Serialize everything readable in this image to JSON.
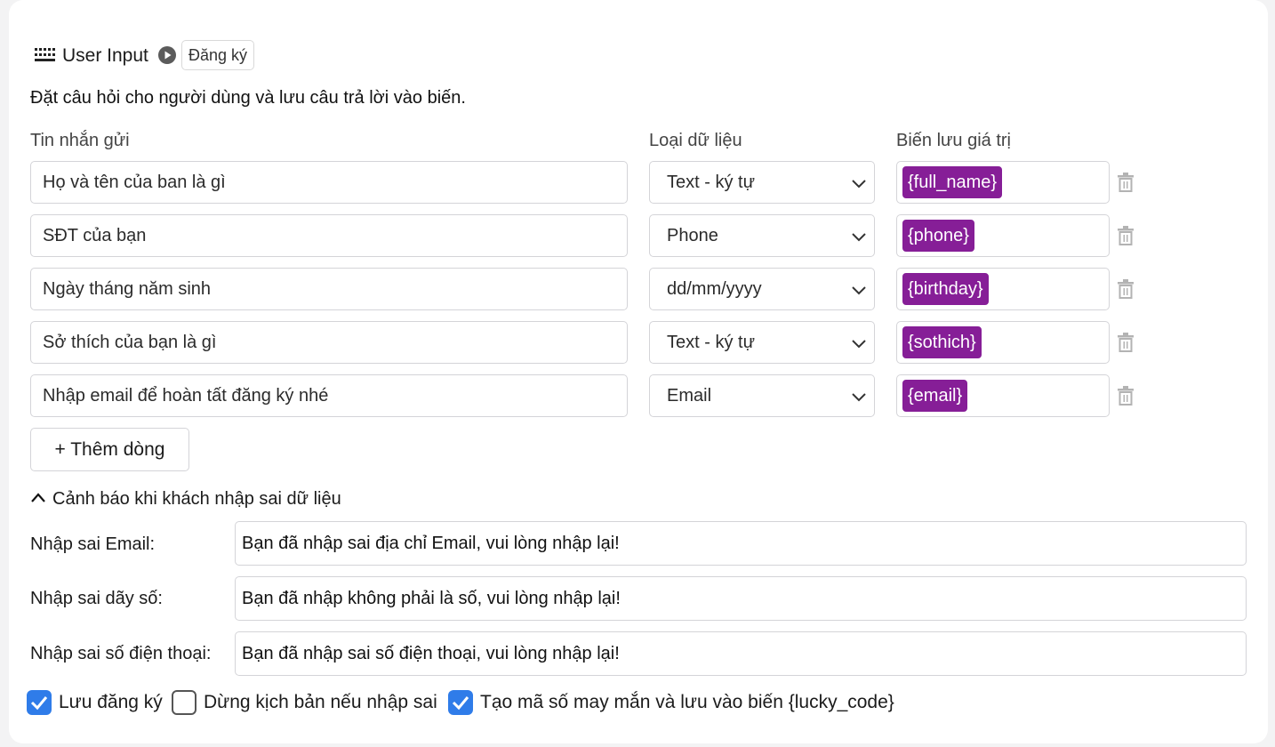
{
  "block": {
    "icon": "keyboard-icon",
    "title": "User Input",
    "run_icon": "play-icon",
    "tag": "Đăng ký",
    "description": "Đặt câu hỏi cho người dùng và lưu câu trả lời vào biến."
  },
  "columns": {
    "message": "Tin nhắn gửi",
    "type": "Loại dữ liệu",
    "variable": "Biến lưu giá trị"
  },
  "rows": [
    {
      "message": "Họ và tên của ban là gì",
      "type": "Text - ký tự",
      "variable": "{full_name}"
    },
    {
      "message": "SĐT của bạn",
      "type": "Phone",
      "variable": "{phone}"
    },
    {
      "message": "Ngày tháng năm sinh",
      "type": "dd/mm/yyyy",
      "variable": "{birthday}"
    },
    {
      "message": "Sở thích của bạn là gì",
      "type": "Text - ký tự",
      "variable": "{sothich}"
    },
    {
      "message": "Nhập email để hoàn tất đăng ký nhé",
      "type": "Email",
      "variable": "{email}"
    }
  ],
  "add_row_label": "+ Thêm dòng",
  "warnings": {
    "title": "Cảnh báo khi khách nhập sai dữ liệu",
    "items": [
      {
        "label": "Nhập sai Email:",
        "value": "Bạn đã nhập sai địa chỉ Email, vui lòng nhập lại!"
      },
      {
        "label": "Nhập sai dãy số:",
        "value": "Bạn đã nhập không phải là số, vui lòng nhập lại!"
      },
      {
        "label": "Nhập sai số điện thoại:",
        "value": "Bạn đã nhập sai số điện thoại, vui lòng nhập lại!"
      }
    ]
  },
  "options": [
    {
      "label": "Lưu đăng ký",
      "checked": true
    },
    {
      "label": "Dừng kịch bản nếu nhập sai",
      "checked": false
    },
    {
      "label": "Tạo mã số may mắn và lưu vào biến {lucky_code}",
      "checked": true
    }
  ],
  "colors": {
    "variable_chip": "#861e97",
    "checkbox_on": "#2f7ce9"
  }
}
